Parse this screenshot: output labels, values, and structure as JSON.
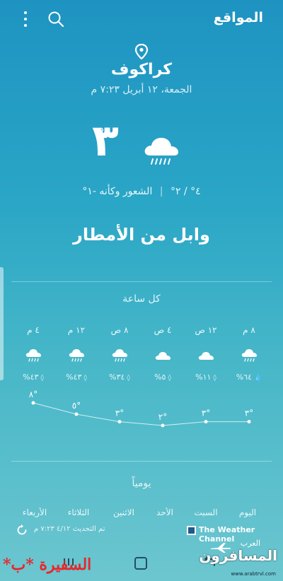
{
  "header": {
    "title": "المواقع"
  },
  "location": {
    "city": "كراكوف",
    "datetime": "الجمعة، ١٢ أبريل ٧:٢٣ م"
  },
  "current": {
    "temp": "٣",
    "deg": "°",
    "hilo": "٤° / ٢°",
    "separator": "|",
    "feels_like": "الشعور وكأنه -١°",
    "condition": "وابل من الأمطار"
  },
  "hourly": {
    "title": "كل ساعة",
    "items": [
      {
        "time": "٨ م",
        "precip": "٦٤%",
        "temp": "٣°",
        "icon": "rain-cloud-icon"
      },
      {
        "time": "١٢ ص",
        "precip": "١١%",
        "temp": "٣°",
        "icon": "cloud-icon"
      },
      {
        "time": "٤ ص",
        "precip": "٥%",
        "temp": "٢°",
        "icon": "cloud-icon"
      },
      {
        "time": "٨ ص",
        "precip": "٣٤%",
        "temp": "٣°",
        "icon": "rain-cloud-icon"
      },
      {
        "time": "١٢ م",
        "precip": "٤٣%",
        "temp": "٥°",
        "icon": "rain-cloud-icon"
      },
      {
        "time": "٤ م",
        "precip": "٤٣%",
        "temp": "٨°",
        "icon": "rain-cloud-icon"
      }
    ]
  },
  "daily": {
    "title": "يومياً",
    "days": [
      "اليوم",
      "السبت",
      "الأحد",
      "الاثنين",
      "الثلاثاء",
      "الأربعاء"
    ]
  },
  "footer": {
    "updated": "تم التحديث ٤/١٢ ٧:٢٣ م",
    "provider": "The Weather Channel"
  },
  "watermark": {
    "left": "السفيرة *ب*",
    "right": "المسافرون",
    "right_small": "العرب",
    "url": "www.arabtrvl.com"
  },
  "colors": {
    "bg_top": "#1e93c2",
    "bg_bottom": "#6cc6cf",
    "watermark_red": "#e8262c"
  }
}
